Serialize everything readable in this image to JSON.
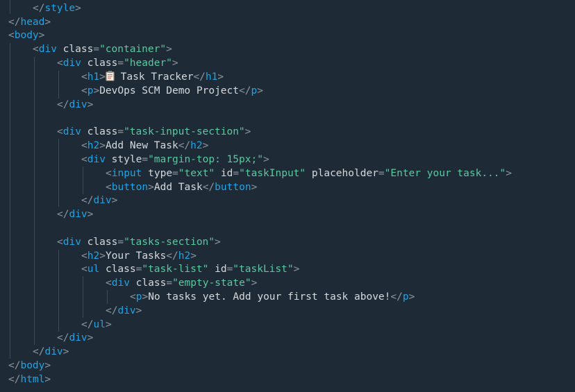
{
  "colors": {
    "background": "#1e2b36",
    "punctuation": "#8b96a0",
    "tag": "#1fa3e6",
    "attribute": "#d6d9dc",
    "string": "#5ac8a0",
    "text": "#d6d9dc",
    "indent_guide": "#3c4b57"
  },
  "code": {
    "l1": {
      "tag": "style"
    },
    "l2": {
      "tag": "head"
    },
    "l3": {
      "tag": "body"
    },
    "l4": {
      "tag": "div",
      "attr": "class",
      "value": "\"container\""
    },
    "l5": {
      "tag": "div",
      "attr": "class",
      "value": "\"header\""
    },
    "l6": {
      "tag": "h1",
      "emoji": "clipboard-icon",
      "text": " Task Tracker",
      "close": "h1"
    },
    "l7": {
      "tag": "p",
      "text": "DevOps SCM Demo Project",
      "close": "p"
    },
    "l8": {
      "tag": "div"
    },
    "l10": {
      "tag": "div",
      "attr": "class",
      "value": "\"task-input-section\""
    },
    "l11": {
      "tag": "h2",
      "text": "Add New Task",
      "close": "h2"
    },
    "l12": {
      "tag": "div",
      "attr": "style",
      "value": "\"margin-top: 15px;\""
    },
    "l13": {
      "tag": "input",
      "attr1": "type",
      "value1": "\"text\"",
      "attr2": "id",
      "value2": "\"taskInput\"",
      "attr3": "placeholder",
      "value3": "\"Enter your task...\""
    },
    "l14": {
      "tag": "button",
      "text": "Add Task",
      "close": "button"
    },
    "l15": {
      "tag": "div"
    },
    "l16": {
      "tag": "div"
    },
    "l18": {
      "tag": "div",
      "attr": "class",
      "value": "\"tasks-section\""
    },
    "l19": {
      "tag": "h2",
      "text": "Your Tasks",
      "close": "h2"
    },
    "l20": {
      "tag": "ul",
      "attr1": "class",
      "value1": "\"task-list\"",
      "attr2": "id",
      "value2": "\"taskList\""
    },
    "l21": {
      "tag": "div",
      "attr": "class",
      "value": "\"empty-state\""
    },
    "l22": {
      "tag": "p",
      "text": "No tasks yet. Add your first task above!",
      "close": "p"
    },
    "l23": {
      "tag": "div"
    },
    "l24": {
      "tag": "ul"
    },
    "l25": {
      "tag": "div"
    },
    "l26": {
      "tag": "div"
    },
    "l27": {
      "tag": "body"
    },
    "l28": {
      "tag": "html"
    }
  }
}
